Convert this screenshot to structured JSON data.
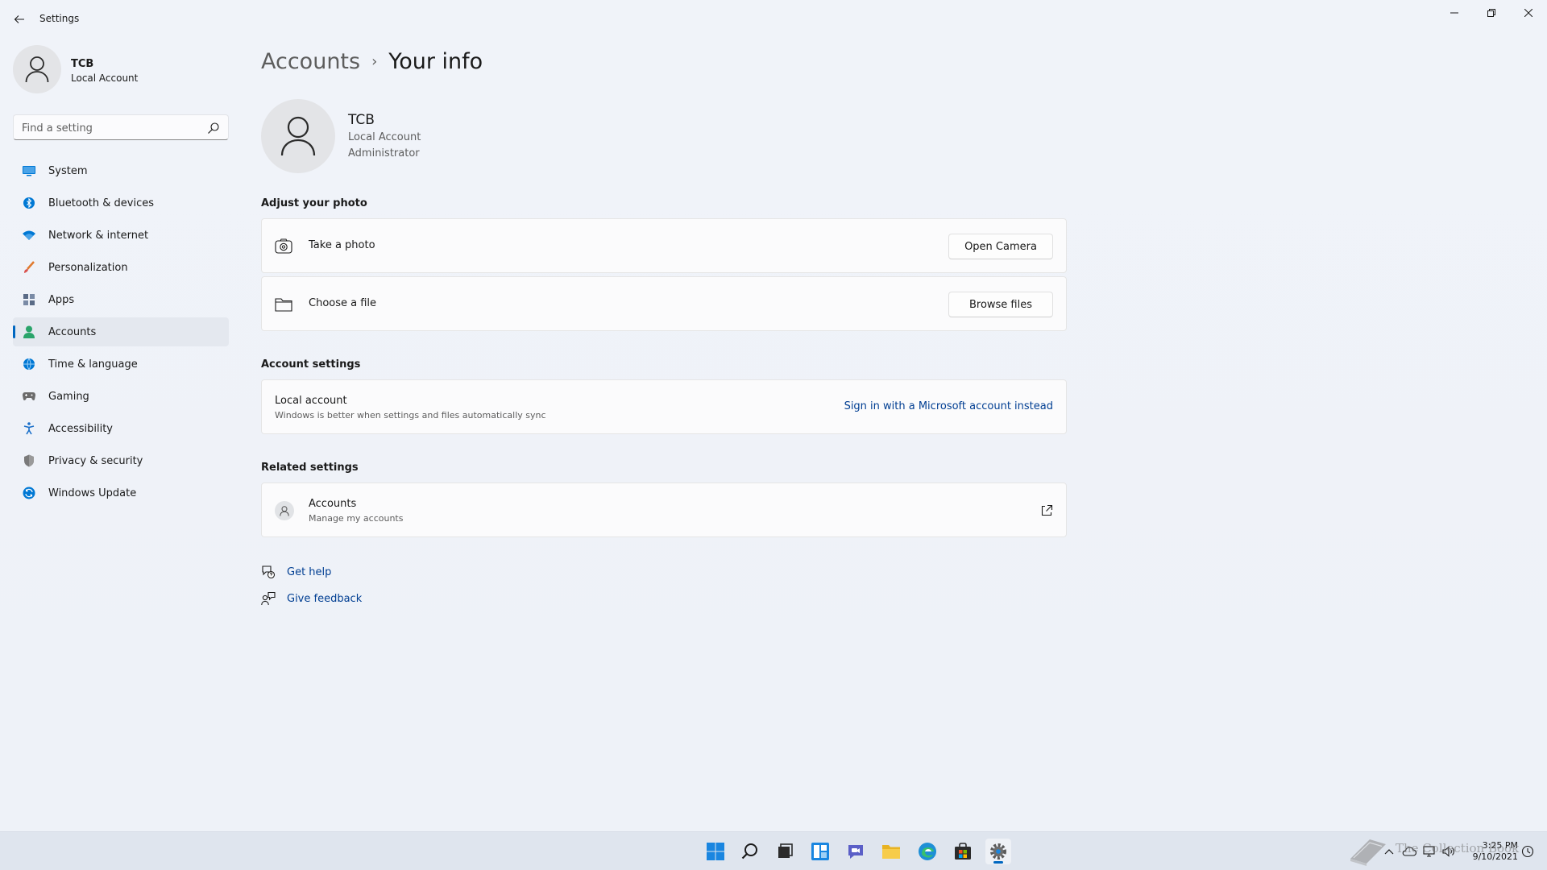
{
  "window": {
    "title": "Settings"
  },
  "profile": {
    "name": "TCB",
    "type": "Local Account"
  },
  "search": {
    "placeholder": "Find a setting"
  },
  "sidebar": {
    "items": [
      {
        "label": "System",
        "icon": "monitor-icon",
        "color": "#0078d4"
      },
      {
        "label": "Bluetooth & devices",
        "icon": "bluetooth-icon",
        "color": "#0078d4"
      },
      {
        "label": "Network & internet",
        "icon": "wifi-icon",
        "color": "#0078d4"
      },
      {
        "label": "Personalization",
        "icon": "brush-icon",
        "color": "#e07a2e"
      },
      {
        "label": "Apps",
        "icon": "apps-icon",
        "color": "#5a6b86"
      },
      {
        "label": "Accounts",
        "icon": "person-icon",
        "color": "#2aa46a",
        "active": true
      },
      {
        "label": "Time & language",
        "icon": "globe-clock-icon",
        "color": "#0078d4"
      },
      {
        "label": "Gaming",
        "icon": "gamepad-icon",
        "color": "#6b6b6b"
      },
      {
        "label": "Accessibility",
        "icon": "accessibility-icon",
        "color": "#1a6fc9"
      },
      {
        "label": "Privacy & security",
        "icon": "shield-icon",
        "color": "#6b6b6b"
      },
      {
        "label": "Windows Update",
        "icon": "update-icon",
        "color": "#0078d4"
      }
    ]
  },
  "breadcrumb": {
    "parent": "Accounts",
    "separator": "›",
    "current": "Your info"
  },
  "user": {
    "name": "TCB",
    "type": "Local Account",
    "role": "Administrator"
  },
  "photo": {
    "heading": "Adjust your photo",
    "take_photo": {
      "label": "Take a photo",
      "button": "Open Camera"
    },
    "choose_file": {
      "label": "Choose a file",
      "button": "Browse files"
    }
  },
  "account_settings": {
    "heading": "Account settings",
    "title": "Local account",
    "subtitle": "Windows is better when settings and files automatically sync",
    "link": "Sign in with a Microsoft account instead"
  },
  "related": {
    "heading": "Related settings",
    "title": "Accounts",
    "subtitle": "Manage my accounts"
  },
  "help": {
    "get_help": "Get help",
    "give_feedback": "Give feedback"
  },
  "taskbar": {
    "clock_time": "3:25 PM",
    "clock_date": "9/10/2021",
    "watermark": "The Collection Book"
  },
  "colors": {
    "accent": "#0067c0",
    "link": "#003e92"
  }
}
